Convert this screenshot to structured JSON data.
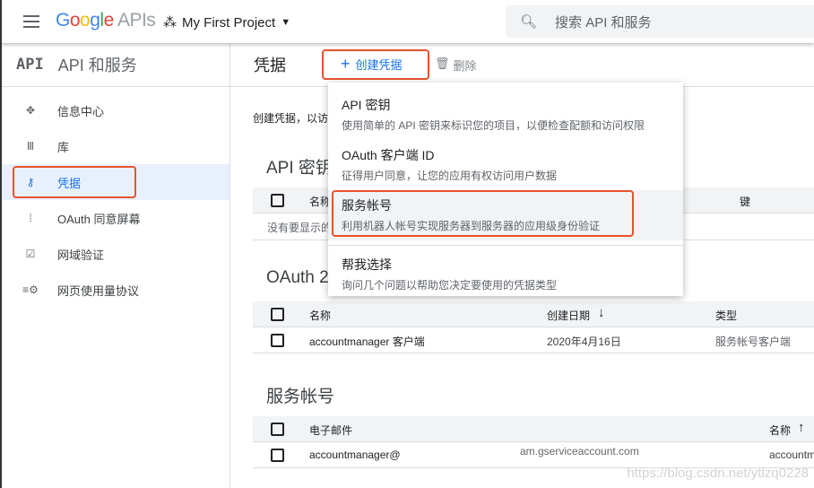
{
  "header": {
    "logo_google": "Google",
    "logo_apis": "APIs",
    "project": "My First Project",
    "search_placeholder": "搜索 API 和服务"
  },
  "sidebar": {
    "title": "API 和服务",
    "logo": "API",
    "items": [
      {
        "label": "信息中心",
        "icon": "dashboard-icon"
      },
      {
        "label": "库",
        "icon": "library-icon"
      },
      {
        "label": "凭据",
        "icon": "key-icon",
        "selected": true
      },
      {
        "label": "OAuth 同意屏幕",
        "icon": "consent-icon"
      },
      {
        "label": "网域验证",
        "icon": "checkbox-icon"
      },
      {
        "label": "网页使用量协议",
        "icon": "settings-list-icon"
      }
    ]
  },
  "main": {
    "title": "凭据",
    "create_label": "创建凭据",
    "delete_label": "删除",
    "description": "创建凭据，以访问",
    "api_keys": {
      "title": "API 密钥",
      "columns": [
        "名称",
        "键"
      ],
      "empty": "没有要显示的"
    },
    "oauth": {
      "title": "OAuth 2",
      "columns": [
        "名称",
        "创建日期",
        "类型"
      ],
      "rows": [
        {
          "name": "accountmanager 客户端",
          "date": "2020年4月16日",
          "type": "服务帐号客户端"
        }
      ]
    },
    "service_accounts": {
      "title": "服务帐号",
      "columns": [
        "电子邮件",
        "名称"
      ],
      "rows": [
        {
          "email_start": "accountmanager@",
          "email_end": "am.gserviceaccount.com",
          "name": "accountm"
        }
      ]
    }
  },
  "menu": {
    "items": [
      {
        "title": "API 密钥",
        "desc": "使用简单的 API 密钥来标识您的项目，以便检查配额和访问权限"
      },
      {
        "title": "OAuth 客户端 ID",
        "desc": "征得用户同意，让您的应用有权访问用户数据"
      },
      {
        "title": "服务帐号",
        "desc": "利用机器人帐号实现服务器到服务器的应用级身份验证"
      },
      {
        "title": "帮我选择",
        "desc": "询问几个问题以帮助您决定要使用的凭据类型"
      }
    ]
  },
  "watermark": "https://blog.csdn.net/ytlzq0228",
  "colors": {
    "accent": "#1a73e8",
    "highlight": "#e8522c"
  }
}
